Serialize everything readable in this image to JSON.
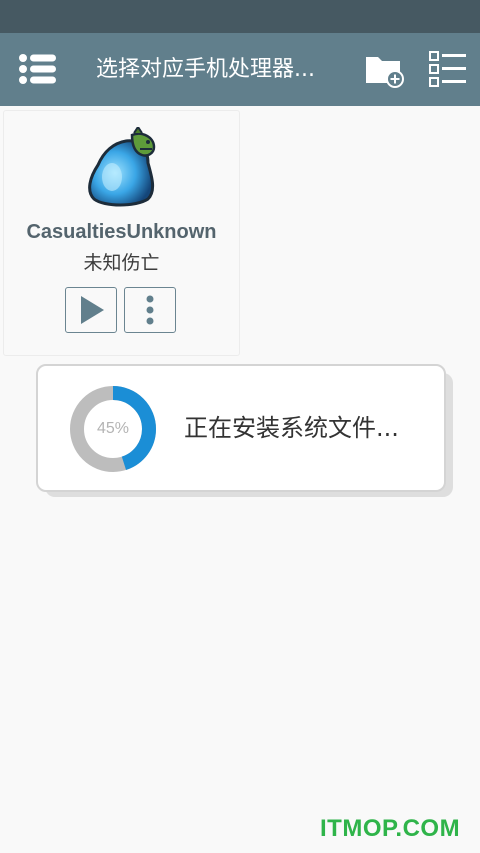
{
  "toolbar": {
    "title": "选择对应手机处理器...",
    "menu_icon": "menu-icon",
    "add_folder_icon": "folder-add-icon",
    "list_icon": "checklist-icon"
  },
  "app": {
    "name": "CasualtiesUnknown",
    "subname": "未知伤亡",
    "icon": "blue-blob-creature-icon"
  },
  "dialog": {
    "progress": 0.45,
    "progress_label": "45%",
    "message": "正在安装系统文件..."
  },
  "watermark": "ITMOP.COM",
  "colors": {
    "status_bar": "#465962",
    "toolbar": "#617f8c",
    "progress_accent": "#1b8ed6",
    "progress_track": "#bdbdbd"
  }
}
